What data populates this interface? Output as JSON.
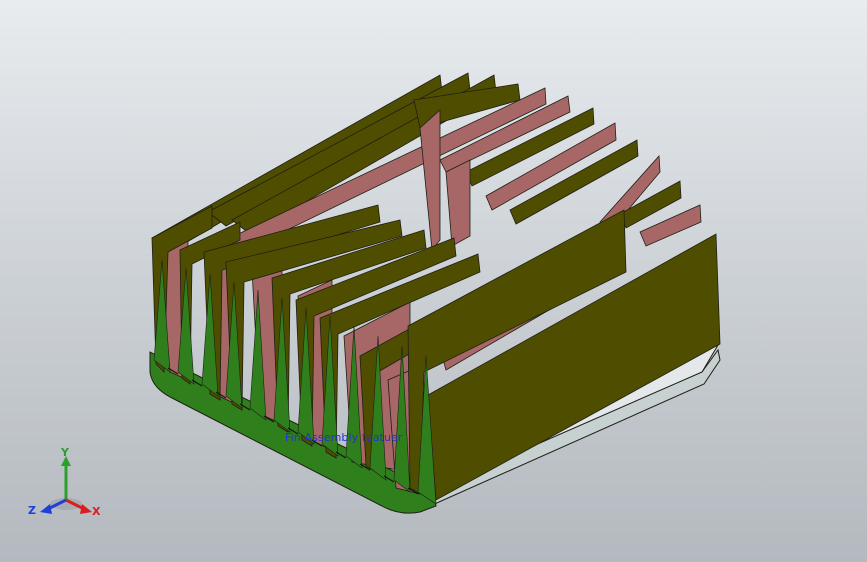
{
  "viewport": {
    "background_top": "#e8ecef",
    "background_bottom": "#b4b9bf"
  },
  "model": {
    "feature_label": "Fin Assembly featuer",
    "colors": {
      "fin_face": "#4f4e00",
      "fin_face_dark": "#3f3e00",
      "fin_side": "#a86767",
      "base_top": "#e4e8ea",
      "base_front": "#c7d1d2",
      "base_green": "#2f7f1d",
      "base_green_dark": "#1f5f12",
      "edge": "#1f1f14"
    },
    "icons": {
      "model": "heatsink-model",
      "triad": "axis-triad-icon"
    }
  },
  "triad": {
    "x_label": "X",
    "y_label": "Y",
    "z_label": "Z",
    "colors": {
      "x": "#d81f1f",
      "y": "#2ca02c",
      "z": "#1f3fd8"
    }
  }
}
